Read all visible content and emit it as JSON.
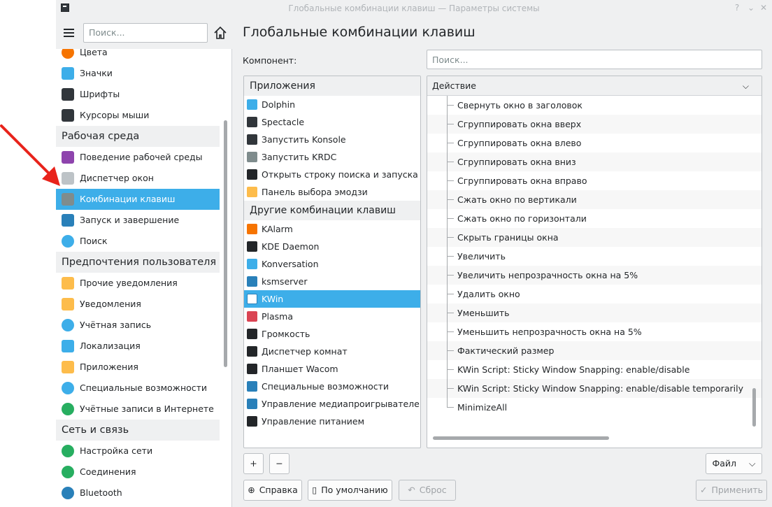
{
  "window": {
    "title": "Глобальные комбинации клавиш — Параметры системы",
    "help_btn": "?",
    "min_btn": "⌄",
    "close_btn": "✕"
  },
  "sidebar": {
    "search_placeholder": "Поиск...",
    "items": [
      {
        "type": "item",
        "label": "Цвета",
        "icon": "colors-icon"
      },
      {
        "type": "item",
        "label": "Значки",
        "icon": "icons-icon"
      },
      {
        "type": "item",
        "label": "Шрифты",
        "icon": "fonts-icon"
      },
      {
        "type": "item",
        "label": "Курсоры мыши",
        "icon": "cursor-icon"
      },
      {
        "type": "section",
        "label": "Рабочая среда"
      },
      {
        "type": "item",
        "label": "Поведение рабочей среды",
        "icon": "workspace-icon"
      },
      {
        "type": "item",
        "label": "Диспетчер окон",
        "icon": "window-manager-icon"
      },
      {
        "type": "item",
        "label": "Комбинации клавиш",
        "icon": "keyboard-icon",
        "active": true
      },
      {
        "type": "item",
        "label": "Запуск и завершение",
        "icon": "startup-icon"
      },
      {
        "type": "item",
        "label": "Поиск",
        "icon": "search-icon"
      },
      {
        "type": "section",
        "label": "Предпочтения пользователя"
      },
      {
        "type": "item",
        "label": "Прочие уведомления",
        "icon": "bell-icon"
      },
      {
        "type": "item",
        "label": "Уведомления",
        "icon": "bell-icon"
      },
      {
        "type": "item",
        "label": "Учётная запись",
        "icon": "user-icon"
      },
      {
        "type": "item",
        "label": "Локализация",
        "icon": "locale-icon"
      },
      {
        "type": "item",
        "label": "Приложения",
        "icon": "star-icon"
      },
      {
        "type": "item",
        "label": "Специальные возможности",
        "icon": "accessibility-icon"
      },
      {
        "type": "item",
        "label": "Учётные записи в Интернете",
        "icon": "globe-icon"
      },
      {
        "type": "section",
        "label": "Сеть и связь"
      },
      {
        "type": "item",
        "label": "Настройка сети",
        "icon": "globe-icon"
      },
      {
        "type": "item",
        "label": "Соединения",
        "icon": "globe-icon"
      },
      {
        "type": "item",
        "label": "Bluetooth",
        "icon": "bluetooth-icon"
      }
    ]
  },
  "main": {
    "title": "Глобальные комбинации клавиш",
    "component_label": "Компонент:",
    "search_placeholder": "Поиск...",
    "left_list": [
      {
        "type": "section",
        "label": "Приложения"
      },
      {
        "type": "item",
        "label": "Dolphin",
        "color": "#3daee9"
      },
      {
        "type": "item",
        "label": "Spectacle",
        "color": "#31363b"
      },
      {
        "type": "item",
        "label": "Запустить Konsole",
        "color": "#31363b"
      },
      {
        "type": "item",
        "label": "Запустить KRDC",
        "color": "#7f8c8d"
      },
      {
        "type": "item",
        "label": "Открыть строку поиска и запуска KR...",
        "color": "#232629"
      },
      {
        "type": "item",
        "label": "Панель выбора эмодзи",
        "color": "#fdbc4b"
      },
      {
        "type": "section",
        "label": "Другие комбинации клавиш"
      },
      {
        "type": "item",
        "label": "KAlarm",
        "color": "#f67400"
      },
      {
        "type": "item",
        "label": "KDE Daemon",
        "color": "#232629"
      },
      {
        "type": "item",
        "label": "Konversation",
        "color": "#3daee9"
      },
      {
        "type": "item",
        "label": "ksmserver",
        "color": "#2980b9"
      },
      {
        "type": "item",
        "label": "KWin",
        "color": "#ffffff",
        "active": true
      },
      {
        "type": "item",
        "label": "Plasma",
        "color": "#da4453"
      },
      {
        "type": "item",
        "label": "Громкость",
        "color": "#232629"
      },
      {
        "type": "item",
        "label": "Диспетчер комнат",
        "color": "#232629"
      },
      {
        "type": "item",
        "label": "Планшет Wacom",
        "color": "#232629"
      },
      {
        "type": "item",
        "label": "Специальные возможности",
        "color": "#2980b9"
      },
      {
        "type": "item",
        "label": "Управление медиапроигрывателем",
        "color": "#2980b9"
      },
      {
        "type": "item",
        "label": "Управление питанием",
        "color": "#232629"
      }
    ],
    "action_header": "Действие",
    "actions": [
      "Свернуть окно в заголовок",
      "Сгруппировать окна вверх",
      "Сгруппировать окна влево",
      "Сгруппировать окна вниз",
      "Сгруппировать окна вправо",
      "Сжать окно по вертикали",
      "Сжать окно по горизонтали",
      "Скрыть границы окна",
      "Увеличить",
      "Увеличить непрозрачность окна на 5%",
      "Удалить окно",
      "Уменьшить",
      "Уменьшить непрозрачность окна на 5%",
      "Фактический размер",
      "KWin Script: Sticky Window Snapping: enable/disable",
      "KWin Script: Sticky Window Snapping: enable/disable temporarily",
      "MinimizeAll"
    ],
    "buttons": {
      "add": "+",
      "remove": "−",
      "file": "Файл",
      "help": "Справка",
      "defaults": "По умолчанию",
      "reset": "Сброс",
      "apply": "Применить"
    }
  },
  "colors": {
    "accent": "#3daee9",
    "annotation_arrow": "#e8231b"
  }
}
